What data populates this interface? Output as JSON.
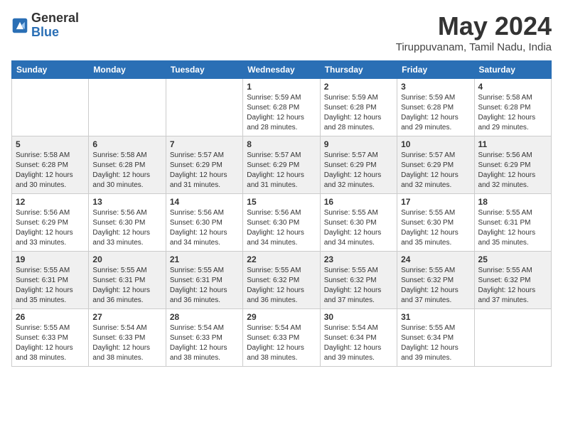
{
  "header": {
    "logo_general": "General",
    "logo_blue": "Blue",
    "month_title": "May 2024",
    "location": "Tiruppuvanam, Tamil Nadu, India"
  },
  "days_of_week": [
    "Sunday",
    "Monday",
    "Tuesday",
    "Wednesday",
    "Thursday",
    "Friday",
    "Saturday"
  ],
  "weeks": [
    [
      {
        "day": "",
        "info": ""
      },
      {
        "day": "",
        "info": ""
      },
      {
        "day": "",
        "info": ""
      },
      {
        "day": "1",
        "info": "Sunrise: 5:59 AM\nSunset: 6:28 PM\nDaylight: 12 hours\nand 28 minutes."
      },
      {
        "day": "2",
        "info": "Sunrise: 5:59 AM\nSunset: 6:28 PM\nDaylight: 12 hours\nand 28 minutes."
      },
      {
        "day": "3",
        "info": "Sunrise: 5:59 AM\nSunset: 6:28 PM\nDaylight: 12 hours\nand 29 minutes."
      },
      {
        "day": "4",
        "info": "Sunrise: 5:58 AM\nSunset: 6:28 PM\nDaylight: 12 hours\nand 29 minutes."
      }
    ],
    [
      {
        "day": "5",
        "info": "Sunrise: 5:58 AM\nSunset: 6:28 PM\nDaylight: 12 hours\nand 30 minutes."
      },
      {
        "day": "6",
        "info": "Sunrise: 5:58 AM\nSunset: 6:28 PM\nDaylight: 12 hours\nand 30 minutes."
      },
      {
        "day": "7",
        "info": "Sunrise: 5:57 AM\nSunset: 6:29 PM\nDaylight: 12 hours\nand 31 minutes."
      },
      {
        "day": "8",
        "info": "Sunrise: 5:57 AM\nSunset: 6:29 PM\nDaylight: 12 hours\nand 31 minutes."
      },
      {
        "day": "9",
        "info": "Sunrise: 5:57 AM\nSunset: 6:29 PM\nDaylight: 12 hours\nand 32 minutes."
      },
      {
        "day": "10",
        "info": "Sunrise: 5:57 AM\nSunset: 6:29 PM\nDaylight: 12 hours\nand 32 minutes."
      },
      {
        "day": "11",
        "info": "Sunrise: 5:56 AM\nSunset: 6:29 PM\nDaylight: 12 hours\nand 32 minutes."
      }
    ],
    [
      {
        "day": "12",
        "info": "Sunrise: 5:56 AM\nSunset: 6:29 PM\nDaylight: 12 hours\nand 33 minutes."
      },
      {
        "day": "13",
        "info": "Sunrise: 5:56 AM\nSunset: 6:30 PM\nDaylight: 12 hours\nand 33 minutes."
      },
      {
        "day": "14",
        "info": "Sunrise: 5:56 AM\nSunset: 6:30 PM\nDaylight: 12 hours\nand 34 minutes."
      },
      {
        "day": "15",
        "info": "Sunrise: 5:56 AM\nSunset: 6:30 PM\nDaylight: 12 hours\nand 34 minutes."
      },
      {
        "day": "16",
        "info": "Sunrise: 5:55 AM\nSunset: 6:30 PM\nDaylight: 12 hours\nand 34 minutes."
      },
      {
        "day": "17",
        "info": "Sunrise: 5:55 AM\nSunset: 6:30 PM\nDaylight: 12 hours\nand 35 minutes."
      },
      {
        "day": "18",
        "info": "Sunrise: 5:55 AM\nSunset: 6:31 PM\nDaylight: 12 hours\nand 35 minutes."
      }
    ],
    [
      {
        "day": "19",
        "info": "Sunrise: 5:55 AM\nSunset: 6:31 PM\nDaylight: 12 hours\nand 35 minutes."
      },
      {
        "day": "20",
        "info": "Sunrise: 5:55 AM\nSunset: 6:31 PM\nDaylight: 12 hours\nand 36 minutes."
      },
      {
        "day": "21",
        "info": "Sunrise: 5:55 AM\nSunset: 6:31 PM\nDaylight: 12 hours\nand 36 minutes."
      },
      {
        "day": "22",
        "info": "Sunrise: 5:55 AM\nSunset: 6:32 PM\nDaylight: 12 hours\nand 36 minutes."
      },
      {
        "day": "23",
        "info": "Sunrise: 5:55 AM\nSunset: 6:32 PM\nDaylight: 12 hours\nand 37 minutes."
      },
      {
        "day": "24",
        "info": "Sunrise: 5:55 AM\nSunset: 6:32 PM\nDaylight: 12 hours\nand 37 minutes."
      },
      {
        "day": "25",
        "info": "Sunrise: 5:55 AM\nSunset: 6:32 PM\nDaylight: 12 hours\nand 37 minutes."
      }
    ],
    [
      {
        "day": "26",
        "info": "Sunrise: 5:55 AM\nSunset: 6:33 PM\nDaylight: 12 hours\nand 38 minutes."
      },
      {
        "day": "27",
        "info": "Sunrise: 5:54 AM\nSunset: 6:33 PM\nDaylight: 12 hours\nand 38 minutes."
      },
      {
        "day": "28",
        "info": "Sunrise: 5:54 AM\nSunset: 6:33 PM\nDaylight: 12 hours\nand 38 minutes."
      },
      {
        "day": "29",
        "info": "Sunrise: 5:54 AM\nSunset: 6:33 PM\nDaylight: 12 hours\nand 38 minutes."
      },
      {
        "day": "30",
        "info": "Sunrise: 5:54 AM\nSunset: 6:34 PM\nDaylight: 12 hours\nand 39 minutes."
      },
      {
        "day": "31",
        "info": "Sunrise: 5:55 AM\nSunset: 6:34 PM\nDaylight: 12 hours\nand 39 minutes."
      },
      {
        "day": "",
        "info": ""
      }
    ]
  ]
}
